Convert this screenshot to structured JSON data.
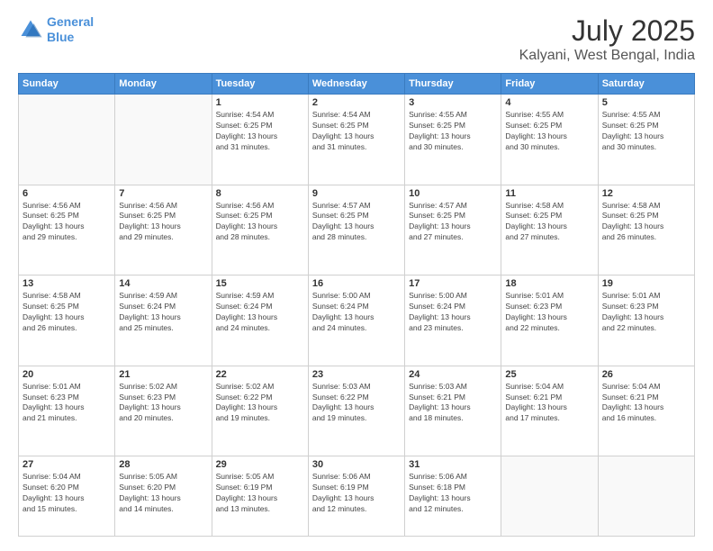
{
  "logo": {
    "line1": "General",
    "line2": "Blue"
  },
  "title": "July 2025",
  "subtitle": "Kalyani, West Bengal, India",
  "header_days": [
    "Sunday",
    "Monday",
    "Tuesday",
    "Wednesday",
    "Thursday",
    "Friday",
    "Saturday"
  ],
  "weeks": [
    [
      {
        "day": "",
        "info": ""
      },
      {
        "day": "",
        "info": ""
      },
      {
        "day": "1",
        "info": "Sunrise: 4:54 AM\nSunset: 6:25 PM\nDaylight: 13 hours\nand 31 minutes."
      },
      {
        "day": "2",
        "info": "Sunrise: 4:54 AM\nSunset: 6:25 PM\nDaylight: 13 hours\nand 31 minutes."
      },
      {
        "day": "3",
        "info": "Sunrise: 4:55 AM\nSunset: 6:25 PM\nDaylight: 13 hours\nand 30 minutes."
      },
      {
        "day": "4",
        "info": "Sunrise: 4:55 AM\nSunset: 6:25 PM\nDaylight: 13 hours\nand 30 minutes."
      },
      {
        "day": "5",
        "info": "Sunrise: 4:55 AM\nSunset: 6:25 PM\nDaylight: 13 hours\nand 30 minutes."
      }
    ],
    [
      {
        "day": "6",
        "info": "Sunrise: 4:56 AM\nSunset: 6:25 PM\nDaylight: 13 hours\nand 29 minutes."
      },
      {
        "day": "7",
        "info": "Sunrise: 4:56 AM\nSunset: 6:25 PM\nDaylight: 13 hours\nand 29 minutes."
      },
      {
        "day": "8",
        "info": "Sunrise: 4:56 AM\nSunset: 6:25 PM\nDaylight: 13 hours\nand 28 minutes."
      },
      {
        "day": "9",
        "info": "Sunrise: 4:57 AM\nSunset: 6:25 PM\nDaylight: 13 hours\nand 28 minutes."
      },
      {
        "day": "10",
        "info": "Sunrise: 4:57 AM\nSunset: 6:25 PM\nDaylight: 13 hours\nand 27 minutes."
      },
      {
        "day": "11",
        "info": "Sunrise: 4:58 AM\nSunset: 6:25 PM\nDaylight: 13 hours\nand 27 minutes."
      },
      {
        "day": "12",
        "info": "Sunrise: 4:58 AM\nSunset: 6:25 PM\nDaylight: 13 hours\nand 26 minutes."
      }
    ],
    [
      {
        "day": "13",
        "info": "Sunrise: 4:58 AM\nSunset: 6:25 PM\nDaylight: 13 hours\nand 26 minutes."
      },
      {
        "day": "14",
        "info": "Sunrise: 4:59 AM\nSunset: 6:24 PM\nDaylight: 13 hours\nand 25 minutes."
      },
      {
        "day": "15",
        "info": "Sunrise: 4:59 AM\nSunset: 6:24 PM\nDaylight: 13 hours\nand 24 minutes."
      },
      {
        "day": "16",
        "info": "Sunrise: 5:00 AM\nSunset: 6:24 PM\nDaylight: 13 hours\nand 24 minutes."
      },
      {
        "day": "17",
        "info": "Sunrise: 5:00 AM\nSunset: 6:24 PM\nDaylight: 13 hours\nand 23 minutes."
      },
      {
        "day": "18",
        "info": "Sunrise: 5:01 AM\nSunset: 6:23 PM\nDaylight: 13 hours\nand 22 minutes."
      },
      {
        "day": "19",
        "info": "Sunrise: 5:01 AM\nSunset: 6:23 PM\nDaylight: 13 hours\nand 22 minutes."
      }
    ],
    [
      {
        "day": "20",
        "info": "Sunrise: 5:01 AM\nSunset: 6:23 PM\nDaylight: 13 hours\nand 21 minutes."
      },
      {
        "day": "21",
        "info": "Sunrise: 5:02 AM\nSunset: 6:23 PM\nDaylight: 13 hours\nand 20 minutes."
      },
      {
        "day": "22",
        "info": "Sunrise: 5:02 AM\nSunset: 6:22 PM\nDaylight: 13 hours\nand 19 minutes."
      },
      {
        "day": "23",
        "info": "Sunrise: 5:03 AM\nSunset: 6:22 PM\nDaylight: 13 hours\nand 19 minutes."
      },
      {
        "day": "24",
        "info": "Sunrise: 5:03 AM\nSunset: 6:21 PM\nDaylight: 13 hours\nand 18 minutes."
      },
      {
        "day": "25",
        "info": "Sunrise: 5:04 AM\nSunset: 6:21 PM\nDaylight: 13 hours\nand 17 minutes."
      },
      {
        "day": "26",
        "info": "Sunrise: 5:04 AM\nSunset: 6:21 PM\nDaylight: 13 hours\nand 16 minutes."
      }
    ],
    [
      {
        "day": "27",
        "info": "Sunrise: 5:04 AM\nSunset: 6:20 PM\nDaylight: 13 hours\nand 15 minutes."
      },
      {
        "day": "28",
        "info": "Sunrise: 5:05 AM\nSunset: 6:20 PM\nDaylight: 13 hours\nand 14 minutes."
      },
      {
        "day": "29",
        "info": "Sunrise: 5:05 AM\nSunset: 6:19 PM\nDaylight: 13 hours\nand 13 minutes."
      },
      {
        "day": "30",
        "info": "Sunrise: 5:06 AM\nSunset: 6:19 PM\nDaylight: 13 hours\nand 12 minutes."
      },
      {
        "day": "31",
        "info": "Sunrise: 5:06 AM\nSunset: 6:18 PM\nDaylight: 13 hours\nand 12 minutes."
      },
      {
        "day": "",
        "info": ""
      },
      {
        "day": "",
        "info": ""
      }
    ]
  ]
}
